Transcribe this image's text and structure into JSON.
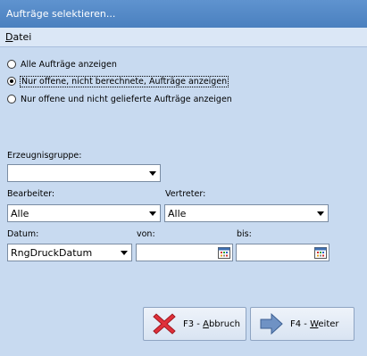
{
  "window": {
    "title": "Aufträge selektieren..."
  },
  "menu": {
    "datei_accel": "D",
    "datei_rest": "atei"
  },
  "options": {
    "all": "Alle Aufträge anzeigen",
    "open_not_billed": "Nur offene, nicht berechnete, Aufträge anzeigen",
    "open_not_delivered": "Nur offene und nicht gelieferte Aufträge anzeigen"
  },
  "product_group": {
    "label": "Erzeugnisgruppe:",
    "value": ""
  },
  "editor": {
    "label": "Bearbeiter:",
    "value": "Alle"
  },
  "representative": {
    "label": "Vertreter:",
    "value": "Alle"
  },
  "date": {
    "label": "Datum:",
    "value": "RngDruckDatum"
  },
  "from": {
    "label": "von:",
    "value": ""
  },
  "to": {
    "label": "bis:",
    "value": ""
  },
  "buttons": {
    "cancel_prefix": "F3 - ",
    "cancel_accel": "A",
    "cancel_rest": "bbruch",
    "next_prefix": "F4 - ",
    "next_accel": "W",
    "next_rest": "eiter"
  },
  "colors": {
    "titlebar": "#4a80bf",
    "background": "#c8daf0",
    "cancel_icon": "#e0303a",
    "next_icon": "#6f92c4"
  }
}
